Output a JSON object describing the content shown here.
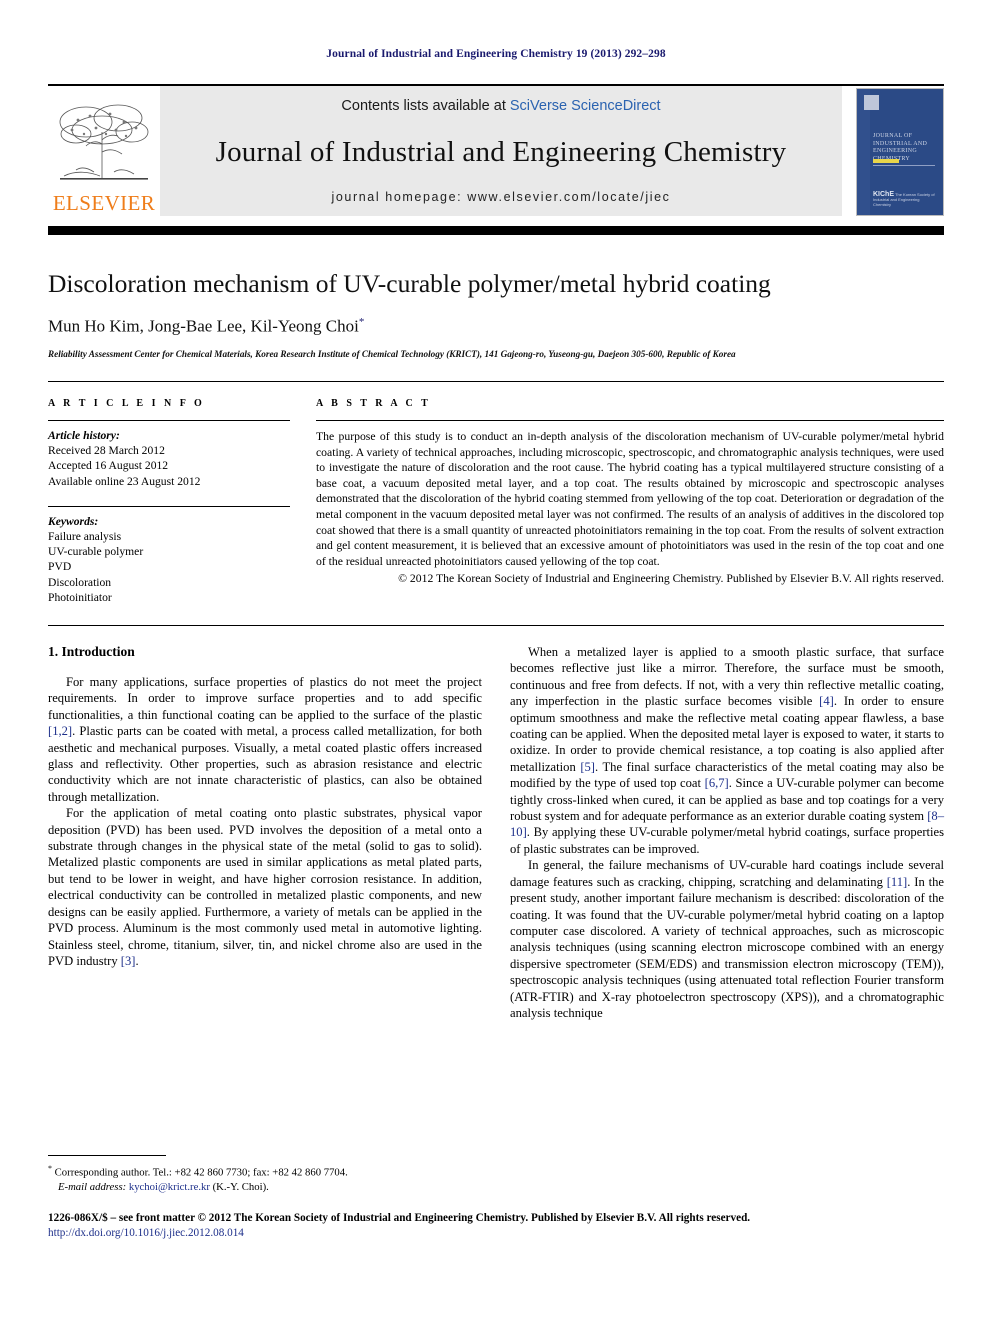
{
  "running_head": "Journal of Industrial and Engineering Chemistry 19 (2013) 292–298",
  "masthead": {
    "publisher_logo_word": "ELSEVIER",
    "contents_prefix": "Contents lists available at ",
    "contents_link": "SciVerse ScienceDirect",
    "journal_title": "Journal of Industrial and Engineering Chemistry",
    "homepage": "journal homepage: www.elsevier.com/locate/jiec",
    "cover": {
      "title": "Journal of Industrial and Engineering Chemistry",
      "footer_mark": "KIChE",
      "footer_text": "The Korean Society of Industrial and Engineering Chemistry"
    }
  },
  "article": {
    "title": "Discoloration mechanism of UV-curable polymer/metal hybrid coating",
    "authors": "Mun Ho Kim, Jong-Bae Lee, Kil-Yeong Choi",
    "corresponding_marker": "*",
    "affiliation": "Reliability Assessment Center for Chemical Materials, Korea Research Institute of Chemical Technology (KRICT), 141 Gajeong-ro, Yuseong-gu, Daejeon 305-600, Republic of Korea"
  },
  "article_info": {
    "heading": "A R T I C L E   I N F O",
    "history_label": "Article history:",
    "history": [
      "Received 28 March 2012",
      "Accepted 16 August 2012",
      "Available online 23 August 2012"
    ],
    "keywords_label": "Keywords:",
    "keywords": [
      "Failure analysis",
      "UV-curable polymer",
      "PVD",
      "Discoloration",
      "Photoinitiator"
    ]
  },
  "abstract": {
    "heading": "A B S T R A C T",
    "text": "The purpose of this study is to conduct an in-depth analysis of the discoloration mechanism of UV-curable polymer/metal hybrid coating. A variety of technical approaches, including microscopic, spectroscopic, and chromatographic analysis techniques, were used to investigate the nature of discoloration and the root cause. The hybrid coating has a typical multilayered structure consisting of a base coat, a vacuum deposited metal layer, and a top coat. The results obtained by microscopic and spectroscopic analyses demonstrated that the discoloration of the hybrid coating stemmed from yellowing of the top coat. Deterioration or degradation of the metal component in the vacuum deposited metal layer was not confirmed. The results of an analysis of additives in the discolored top coat showed that there is a small quantity of unreacted photoinitiators remaining in the top coat. From the results of solvent extraction and gel content measurement, it is believed that an excessive amount of photoinitiators was used in the resin of the top coat and one of the residual unreacted photoinitiators caused yellowing of the top coat.",
    "copyright": "© 2012 The Korean Society of Industrial and Engineering Chemistry. Published by Elsevier B.V. All rights reserved."
  },
  "body": {
    "section_number_title": "1. Introduction",
    "left_paragraphs": [
      "For many applications, surface properties of plastics do not meet the project requirements. In order to improve surface properties and to add specific functionalities, a thin functional coating can be applied to the surface of the plastic [1,2]. Plastic parts can be coated with metal, a process called metallization, for both aesthetic and mechanical purposes. Visually, a metal coated plastic offers increased glass and reflectivity. Other properties, such as abrasion resistance and electric conductivity which are not innate characteristic of plastics, can also be obtained through metallization.",
      "For the application of metal coating onto plastic substrates, physical vapor deposition (PVD) has been used. PVD involves the deposition of a metal onto a substrate through changes in the physical state of the metal (solid to gas to solid). Metalized plastic components are used in similar applications as metal plated parts, but tend to be lower in weight, and have higher corrosion resistance. In addition, electrical conductivity can be controlled in metalized plastic components, and new designs can be easily applied. Furthermore, a variety of metals can be applied in the PVD process. Aluminum is the most commonly used metal in automotive lighting. Stainless steel, chrome, titanium, silver, tin, and nickel chrome also are used in the PVD industry [3]."
    ],
    "right_paragraphs": [
      "When a metalized layer is applied to a smooth plastic surface, that surface becomes reflective just like a mirror. Therefore, the surface must be smooth, continuous and free from defects. If not, with a very thin reflective metallic coating, any imperfection in the plastic surface becomes visible [4]. In order to ensure optimum smoothness and make the reflective metal coating appear flawless, a base coating can be applied. When the deposited metal layer is exposed to water, it starts to oxidize. In order to provide chemical resistance, a top coating is also applied after metallization [5]. The final surface characteristics of the metal coating may also be modified by the type of used top coat [6,7]. Since a UV-curable polymer can become tightly cross-linked when cured, it can be applied as base and top coatings for a very robust system and for adequate performance as an exterior durable coating system [8–10]. By applying these UV-curable polymer/metal hybrid coatings, surface properties of plastic substrates can be improved.",
      "In general, the failure mechanisms of UV-curable hard coatings include several damage features such as cracking, chipping, scratching and delaminating [11]. In the present study, another important failure mechanism is described: discoloration of the coating. It was found that the UV-curable polymer/metal hybrid coating on a laptop computer case discolored. A variety of technical approaches, such as microscopic analysis techniques (using scanning electron microscope combined with an energy dispersive spectrometer (SEM/EDS) and transmission electron microscopy (TEM)), spectroscopic analysis techniques (using attenuated total reflection Fourier transform (ATR-FTIR) and X-ray photoelectron spectroscopy (XPS)), and a chromatographic analysis technique"
    ]
  },
  "footnote": {
    "marker": "*",
    "line1": "Corresponding author. Tel.: +82 42 860 7730; fax: +82 42 860 7704.",
    "email_label": "E-mail address:",
    "email": "kychoi@krict.re.kr",
    "email_suffix": "(K.-Y. Choi)."
  },
  "footer": {
    "front_matter": "1226-086X/$ – see front matter © 2012 The Korean Society of Industrial and Engineering Chemistry. Published by Elsevier B.V. All rights reserved.",
    "doi": "http://dx.doi.org/10.1016/j.jiec.2012.08.014"
  },
  "colors": {
    "running_head": "#1a1a6e",
    "link": "#2b63b0",
    "reference": "#1d2f8a",
    "elsevier_orange": "#ef7d1a",
    "masthead_bg": "#e9e9e9",
    "cover_blue": "#2b4a86"
  }
}
